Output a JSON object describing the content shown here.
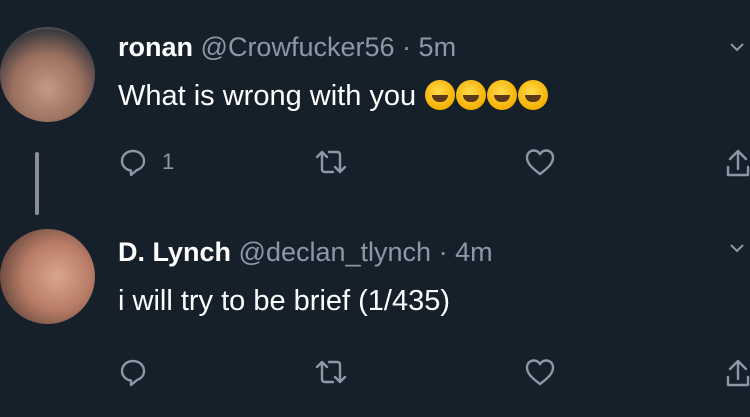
{
  "colors": {
    "background": "#15202b",
    "secondary_text": "#8b98a5",
    "icon": "#8b98a5"
  },
  "tweets": [
    {
      "name": "ronan",
      "handle": "@Crowfucker56",
      "separator": "·",
      "time": "5m",
      "text": "What is  wrong with you",
      "emoji_count": 4,
      "reply_count": "1"
    },
    {
      "name": "D. Lynch",
      "handle": "@declan_tlynch",
      "separator": "·",
      "time": "4m",
      "text": "i will try to be brief (1/435)"
    }
  ],
  "icons": [
    "reply-icon",
    "retweet-icon",
    "like-icon",
    "share-icon",
    "chevron-down-icon"
  ]
}
